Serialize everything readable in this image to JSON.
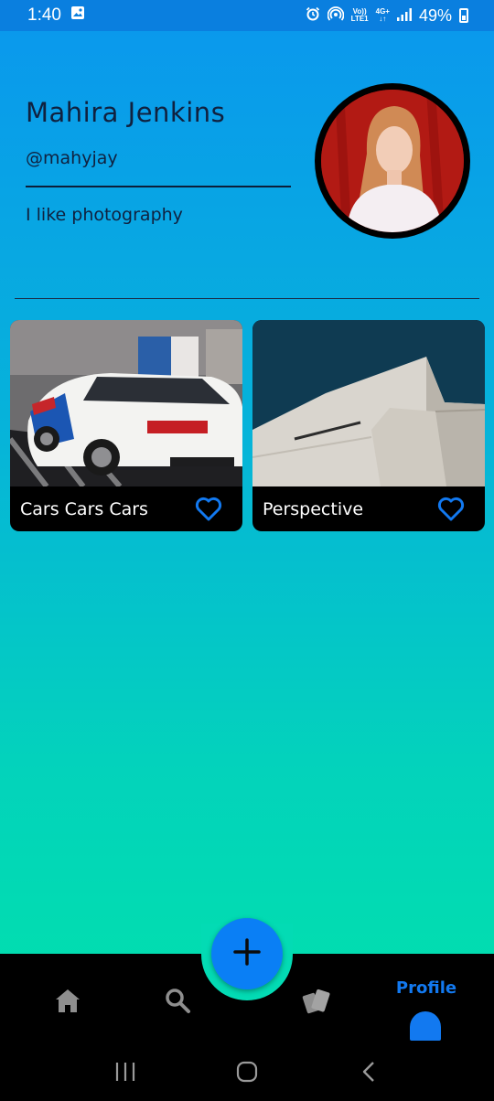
{
  "status_bar": {
    "time": "1:40",
    "network_top": "Vo))",
    "network_bottom": "LTE1",
    "generation": "4G+",
    "battery": "49%"
  },
  "profile": {
    "name": "Mahira Jenkins",
    "handle": "@mahyjay",
    "bio": "I like photography"
  },
  "posts": [
    {
      "title": "Cars Cars Cars",
      "liked": false
    },
    {
      "title": "Perspective",
      "liked": false
    }
  ],
  "nav": {
    "items": [
      {
        "icon": "home-icon"
      },
      {
        "icon": "search-icon"
      },
      {
        "icon": "cards-icon"
      },
      {
        "icon": "profile-icon",
        "label": "Profile",
        "active": true
      }
    ],
    "fab_icon": "plus-icon"
  },
  "colors": {
    "accent": "#1279f0",
    "fab": "#0a7ff5",
    "gradient_top": "#0a97ee",
    "gradient_bottom": "#00e4a8"
  }
}
